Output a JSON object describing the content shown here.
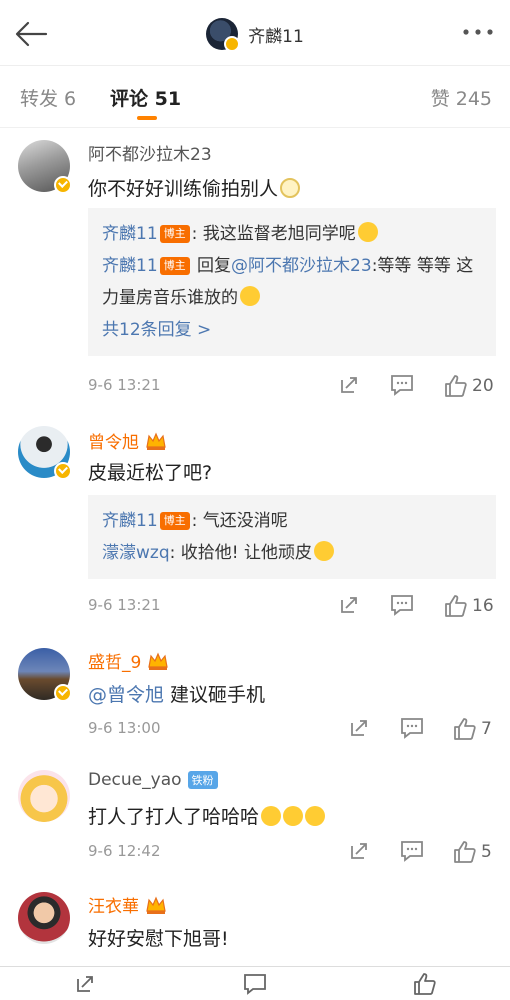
{
  "header": {
    "title": "齐麟11"
  },
  "tabs": {
    "repost": "转发 6",
    "comment": "评论 51",
    "like": "赞 245"
  },
  "comments": [
    {
      "name": "阿不都沙拉木23",
      "text": "你不好好训练偷拍别人",
      "replies": [
        {
          "name": "齐麟11",
          "badge": "博主",
          "text": ": 我这监督老旭同学呢"
        },
        {
          "name": "齐麟11",
          "badge": "博主",
          "text_before": "回复",
          "mention": "@阿不都沙拉木23",
          "text": ":等等 等等 这力量房音乐谁放的"
        }
      ],
      "more": "共12条回复 >",
      "time": "9-6 13:21",
      "likes": "20"
    },
    {
      "name": "曾令旭",
      "text": "皮最近松了吧?",
      "replies": [
        {
          "name": "齐麟11",
          "badge": "博主",
          "text": ": 气还没消呢"
        },
        {
          "name": "濛濛wzq",
          "text": ": 收拾他! 让他顽皮"
        }
      ],
      "time": "9-6 13:21",
      "likes": "16"
    },
    {
      "name": "盛哲_9",
      "mention": "@曾令旭",
      "text": " 建议砸手机",
      "time": "9-6 13:00",
      "likes": "7"
    },
    {
      "name": "Decue_yao",
      "fan_badge": "铁粉",
      "text": "打人了打人了哈哈哈",
      "time": "9-6 12:42",
      "likes": "5"
    },
    {
      "name": "汪衣華",
      "text": "好好安慰下旭哥!"
    }
  ],
  "colors": {
    "accent": "#ff8200",
    "link": "#4c77b0",
    "vip_name": "#f86e00",
    "verified": "#f7b500"
  }
}
